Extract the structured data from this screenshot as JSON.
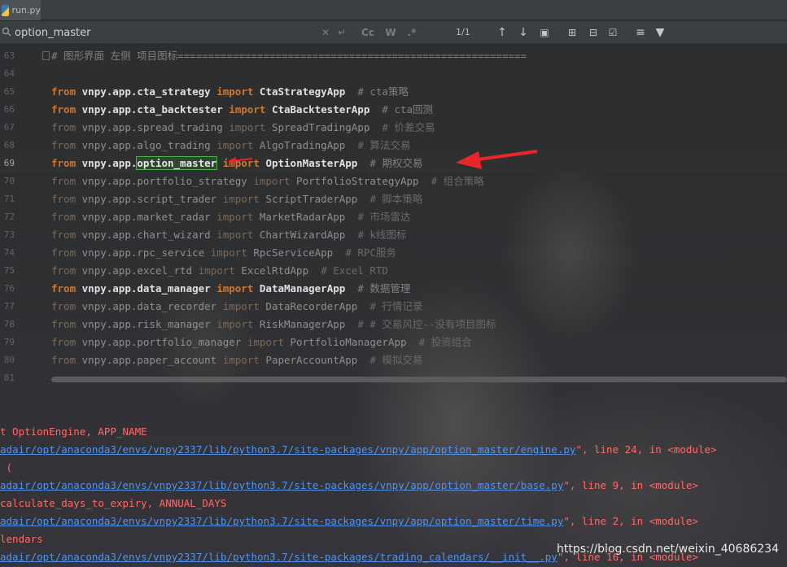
{
  "tab": {
    "label": "run.py"
  },
  "search": {
    "value": "option_master",
    "match_count": "1/1",
    "case_label": "Cc",
    "word_label": "W",
    "regex_label": ".*"
  },
  "editor": {
    "lines": [
      {
        "num": "63",
        "parts": [
          {
            "t": "# 图形界面 左侧 项目图标=========================================================",
            "c": "cm"
          }
        ]
      },
      {
        "num": "64",
        "parts": []
      },
      {
        "num": "65",
        "parts": [
          {
            "t": "from ",
            "c": "kw"
          },
          {
            "t": "vnpy.app.cta_strategy ",
            "c": "mod"
          },
          {
            "t": "import ",
            "c": "kw"
          },
          {
            "t": "CtaStrategyApp",
            "c": "mod"
          },
          {
            "t": "  # cta策略",
            "c": "cm"
          }
        ]
      },
      {
        "num": "66",
        "parts": [
          {
            "t": "from ",
            "c": "kw"
          },
          {
            "t": "vnpy.app.cta_backtester ",
            "c": "mod"
          },
          {
            "t": "import ",
            "c": "kw"
          },
          {
            "t": "CtaBacktesterApp",
            "c": "mod"
          },
          {
            "t": "  # cta回测",
            "c": "cm"
          }
        ]
      },
      {
        "num": "67",
        "parts": [
          {
            "t": "from ",
            "c": "kw-dim"
          },
          {
            "t": "vnpy.app.spread_trading ",
            "c": "mod-dim"
          },
          {
            "t": "import ",
            "c": "kw-dim"
          },
          {
            "t": "SpreadTradingApp",
            "c": "mod-dim"
          },
          {
            "t": "  # 价差交易",
            "c": "cm-dim"
          }
        ]
      },
      {
        "num": "68",
        "parts": [
          {
            "t": "from ",
            "c": "kw-dim"
          },
          {
            "t": "vnpy.app.algo_trading ",
            "c": "mod-dim"
          },
          {
            "t": "import ",
            "c": "kw-dim"
          },
          {
            "t": "AlgoTradingApp",
            "c": "mod-dim"
          },
          {
            "t": "  # 算法交易",
            "c": "cm-dim"
          }
        ]
      },
      {
        "num": "69",
        "current": true,
        "parts": [
          {
            "t": "from ",
            "c": "kw"
          },
          {
            "t": "vnpy.app.",
            "c": "mod"
          },
          {
            "t": "option_master",
            "c": "hl"
          },
          {
            "t": " import ",
            "c": "kw"
          },
          {
            "t": "OptionMasterApp",
            "c": "mod"
          },
          {
            "t": "  # 期权交易",
            "c": "cm"
          }
        ]
      },
      {
        "num": "70",
        "parts": [
          {
            "t": "from ",
            "c": "kw-dim"
          },
          {
            "t": "vnpy.app.portfolio_strategy ",
            "c": "mod-dim"
          },
          {
            "t": "import ",
            "c": "kw-dim"
          },
          {
            "t": "PortfolioStrategyApp",
            "c": "mod-dim"
          },
          {
            "t": "  # 组合策略",
            "c": "cm-dim"
          }
        ]
      },
      {
        "num": "71",
        "parts": [
          {
            "t": "from ",
            "c": "kw-dim"
          },
          {
            "t": "vnpy.app.script_trader ",
            "c": "mod-dim"
          },
          {
            "t": "import ",
            "c": "kw-dim"
          },
          {
            "t": "ScriptTraderApp",
            "c": "mod-dim"
          },
          {
            "t": "  # 脚本策略",
            "c": "cm-dim"
          }
        ]
      },
      {
        "num": "72",
        "parts": [
          {
            "t": "from ",
            "c": "kw-dim"
          },
          {
            "t": "vnpy.app.market_radar ",
            "c": "mod-dim"
          },
          {
            "t": "import ",
            "c": "kw-dim"
          },
          {
            "t": "MarketRadarApp",
            "c": "mod-dim"
          },
          {
            "t": "  # 市场雷达",
            "c": "cm-dim"
          }
        ]
      },
      {
        "num": "73",
        "parts": [
          {
            "t": "from ",
            "c": "kw-dim"
          },
          {
            "t": "vnpy.app.chart_wizard ",
            "c": "mod-dim"
          },
          {
            "t": "import ",
            "c": "kw-dim"
          },
          {
            "t": "ChartWizardApp",
            "c": "mod-dim"
          },
          {
            "t": "  # k线图标",
            "c": "cm-dim"
          }
        ]
      },
      {
        "num": "74",
        "parts": [
          {
            "t": "from ",
            "c": "kw-dim"
          },
          {
            "t": "vnpy.app.rpc_service ",
            "c": "mod-dim"
          },
          {
            "t": "import ",
            "c": "kw-dim"
          },
          {
            "t": "RpcServiceApp",
            "c": "mod-dim"
          },
          {
            "t": "  # RPC服务",
            "c": "cm-dim"
          }
        ]
      },
      {
        "num": "75",
        "parts": [
          {
            "t": "from ",
            "c": "kw-dim"
          },
          {
            "t": "vnpy.app.excel_rtd ",
            "c": "mod-dim"
          },
          {
            "t": "import ",
            "c": "kw-dim"
          },
          {
            "t": "ExcelRtdApp",
            "c": "mod-dim"
          },
          {
            "t": "  # Excel RTD",
            "c": "cm-dim"
          }
        ]
      },
      {
        "num": "76",
        "parts": [
          {
            "t": "from ",
            "c": "kw"
          },
          {
            "t": "vnpy.app.data_manager ",
            "c": "mod"
          },
          {
            "t": "import ",
            "c": "kw"
          },
          {
            "t": "DataManagerApp",
            "c": "mod"
          },
          {
            "t": "  # 数据管理",
            "c": "cm"
          }
        ]
      },
      {
        "num": "77",
        "parts": [
          {
            "t": "from ",
            "c": "kw-dim"
          },
          {
            "t": "vnpy.app.data_recorder ",
            "c": "mod-dim"
          },
          {
            "t": "import ",
            "c": "kw-dim"
          },
          {
            "t": "DataRecorderApp",
            "c": "mod-dim"
          },
          {
            "t": "  # 行情记录",
            "c": "cm-dim"
          }
        ]
      },
      {
        "num": "78",
        "parts": [
          {
            "t": "from ",
            "c": "kw-dim"
          },
          {
            "t": "vnpy.app.risk_manager ",
            "c": "mod-dim"
          },
          {
            "t": "import ",
            "c": "kw-dim"
          },
          {
            "t": "RiskManagerApp",
            "c": "mod-dim"
          },
          {
            "t": "  # # 交易风控--没有项目图标",
            "c": "cm-dim"
          }
        ]
      },
      {
        "num": "79",
        "parts": [
          {
            "t": "from ",
            "c": "kw-dim"
          },
          {
            "t": "vnpy.app.portfolio_manager ",
            "c": "mod-dim"
          },
          {
            "t": "import ",
            "c": "kw-dim"
          },
          {
            "t": "PortfolioManagerApp",
            "c": "mod-dim"
          },
          {
            "t": "  # 投资组合",
            "c": "cm-dim"
          }
        ]
      },
      {
        "num": "80",
        "parts": [
          {
            "t": "from ",
            "c": "kw-dim"
          },
          {
            "t": "vnpy.app.paper_account ",
            "c": "mod-dim"
          },
          {
            "t": "import ",
            "c": "kw-dim"
          },
          {
            "t": "PaperAccountApp",
            "c": "mod-dim"
          },
          {
            "t": "  # 模拟交易",
            "c": "cm-dim"
          }
        ]
      },
      {
        "num": "81",
        "parts": []
      }
    ]
  },
  "console": {
    "lines": [
      [
        {
          "t": "t OptionEngine, APP_NAME",
          "c": "err"
        }
      ],
      [
        {
          "t": "adair/opt/anaconda3/envs/vnpy2337/lib/python3.7/site-packages/vnpy/app/option_master/engine.py",
          "c": "link"
        },
        {
          "t": "\", line 24, in <module>",
          "c": "err"
        }
      ],
      [
        {
          "t": " (",
          "c": "err"
        }
      ],
      [
        {
          "t": "adair/opt/anaconda3/envs/vnpy2337/lib/python3.7/site-packages/vnpy/app/option_master/base.py",
          "c": "link"
        },
        {
          "t": "\", line 9, in <module>",
          "c": "err"
        }
      ],
      [
        {
          "t": "calculate_days_to_expiry, ANNUAL_DAYS",
          "c": "err"
        }
      ],
      [
        {
          "t": "adair/opt/anaconda3/envs/vnpy2337/lib/python3.7/site-packages/vnpy/app/option_master/time.py",
          "c": "link"
        },
        {
          "t": "\", line 2, in <module>",
          "c": "err"
        }
      ],
      [
        {
          "t": "lendars",
          "c": "err"
        }
      ],
      [
        {
          "t": "adair/opt/anaconda3/envs/vnpy2337/lib/python3.7/site-packages/trading_calendars/__init__.py",
          "c": "link"
        },
        {
          "t": "\", line 16, in <module>",
          "c": "err"
        }
      ]
    ]
  },
  "watermark": "https://blog.csdn.net/weixin_40686234",
  "colors": {
    "keyword": "#cc7832",
    "comment": "#808080",
    "error": "#ff6b68",
    "link": "#5394ec",
    "match_box": "#4caf50",
    "arrow": "#e8262a"
  },
  "icons": [
    "python-file-icon",
    "search-icon",
    "clear-icon",
    "history-icon",
    "prev-occurrence-icon",
    "next-occurrence-icon",
    "select-all-icon",
    "add-selection-icon",
    "remove-selection-icon",
    "select-all-occurrences-icon",
    "toggle-options-icon",
    "filter-icon"
  ]
}
